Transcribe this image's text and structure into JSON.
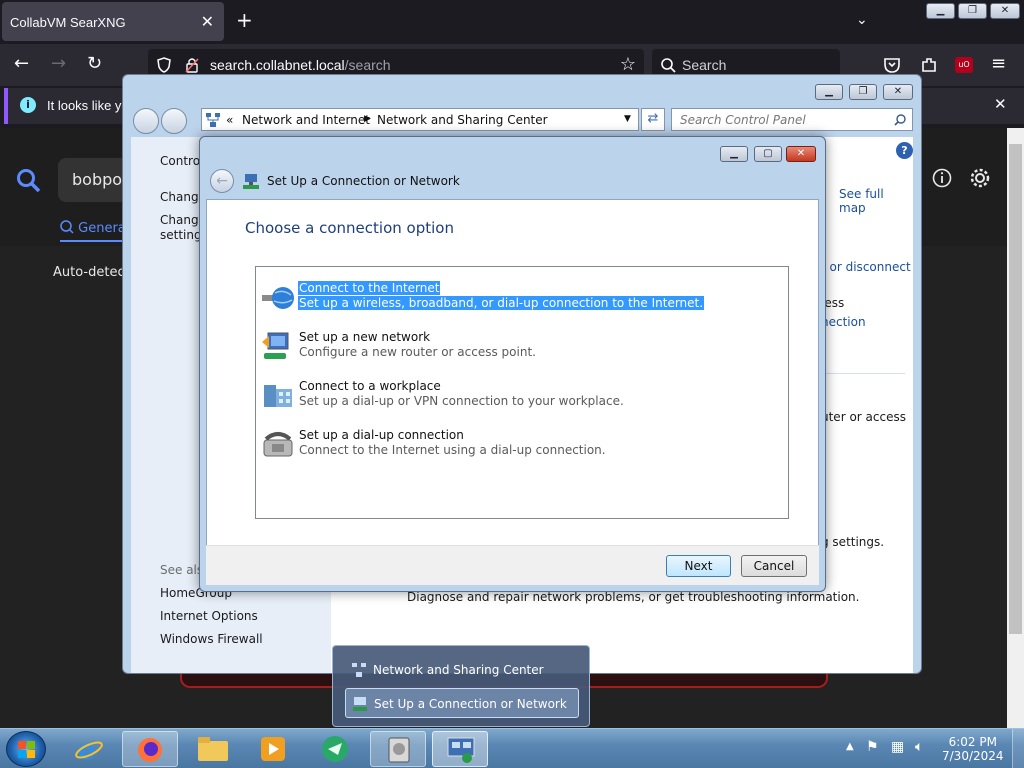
{
  "browser": {
    "tab_title": "CollabVM SearXNG",
    "url_host": "search.collabnet.local",
    "url_path": "/search",
    "search_placeholder": "Search",
    "notification_text": "It looks like yo"
  },
  "webpage": {
    "query_fragment": "bobpor",
    "tab_general": "Genera",
    "autodetect_text": "Auto-detect"
  },
  "control_panel": {
    "breadcrumb": [
      "Network and Internet",
      "Network and Sharing Center"
    ],
    "search_placeholder": "Search Control Panel",
    "left_items": [
      "Control",
      "Change",
      "Change",
      "settings"
    ],
    "see_also_heading": "See also",
    "see_also": [
      "HomeGroup",
      "Internet Options",
      "Windows Firewall"
    ],
    "main_fragments": {
      "see_full_map": "See full map",
      "connect_or_disconnect": "t or disconnect",
      "wireless": "less",
      "connection": "nection",
      "router_or_access": "uter or access",
      "settings": "g settings.",
      "diagnose": "Diagnose and repair network problems, or get troubleshooting information."
    }
  },
  "dialog": {
    "title": "Set Up a Connection or Network",
    "heading": "Choose a connection option",
    "options": [
      {
        "title": "Connect to the Internet",
        "desc": "Set up a wireless, broadband, or dial-up connection to the Internet.",
        "selected": true,
        "icon": "globe-icon"
      },
      {
        "title": "Set up a new network",
        "desc": "Configure a new router or access point.",
        "selected": false,
        "icon": "router-icon"
      },
      {
        "title": "Connect to a workplace",
        "desc": "Set up a dial-up or VPN connection to your workplace.",
        "selected": false,
        "icon": "workplace-icon"
      },
      {
        "title": "Set up a dial-up connection",
        "desc": "Connect to the Internet using a dial-up connection.",
        "selected": false,
        "icon": "phone-icon"
      }
    ],
    "next_label": "Next",
    "cancel_label": "Cancel"
  },
  "taskbar": {
    "thumbnails": [
      "Network and Sharing Center",
      "Set Up a Connection or Network"
    ],
    "time": "6:02 PM",
    "date": "7/30/2024"
  },
  "colors": {
    "selection": "#3399ff",
    "link": "#1a4fa0",
    "dialog_heading": "#1e3f7a"
  }
}
